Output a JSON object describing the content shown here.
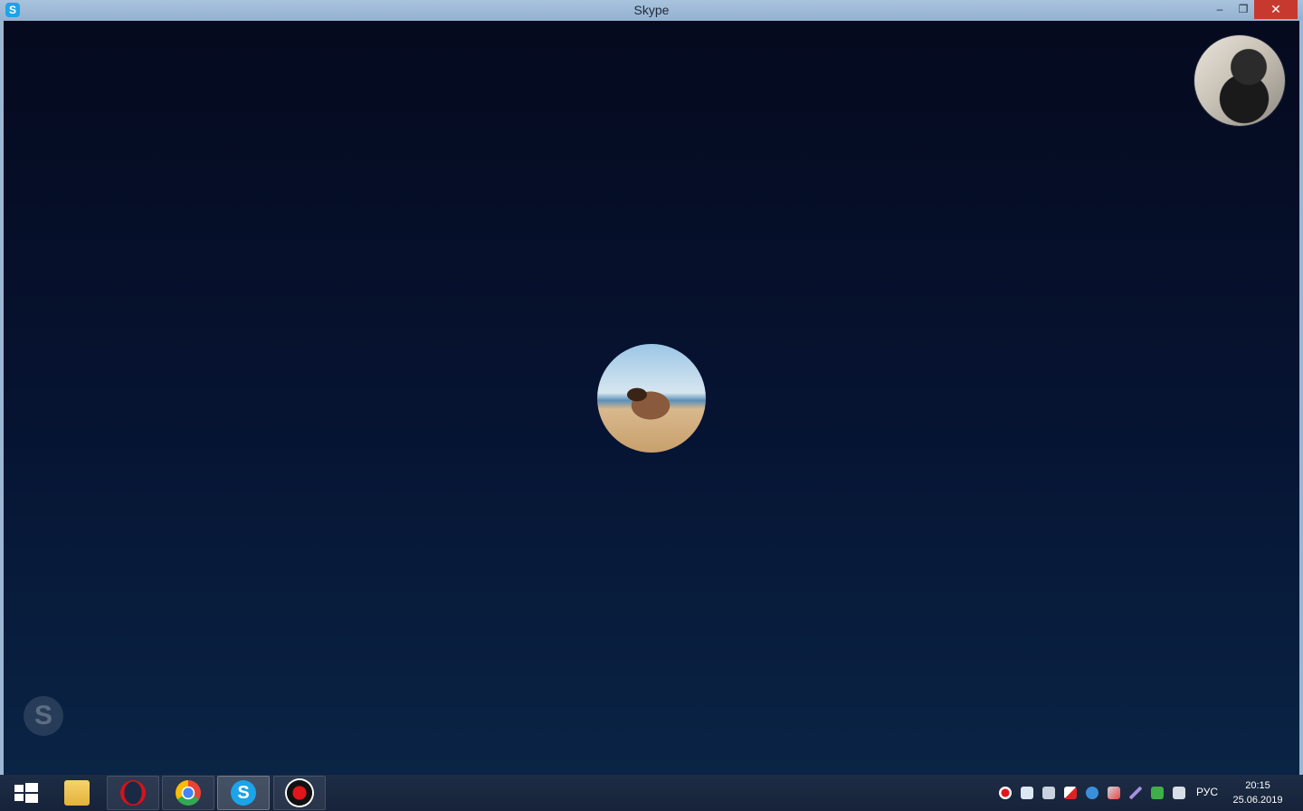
{
  "window": {
    "title": "Skype",
    "app_icon_letter": "S",
    "minimize_glyph": "–",
    "maximize_glyph": "❐",
    "close_glyph": "✕"
  },
  "call": {
    "watermark_letter": "S"
  },
  "taskbar": {
    "apps": [
      {
        "name": "file-explorer",
        "icon": "folder-icon"
      },
      {
        "name": "opera",
        "icon": "opera-icon"
      },
      {
        "name": "chrome",
        "icon": "chrome-icon"
      },
      {
        "name": "skype",
        "icon": "skype-icon",
        "letter": "S",
        "active": true
      },
      {
        "name": "recorder",
        "icon": "record-icon"
      }
    ],
    "language": "РУС",
    "time": "20:15",
    "date": "25.06.2019"
  },
  "colors": {
    "skype_blue": "#1ca3e8",
    "close_red": "#c7392f",
    "opera_red": "#d3131b",
    "record_red": "#e0161b"
  }
}
